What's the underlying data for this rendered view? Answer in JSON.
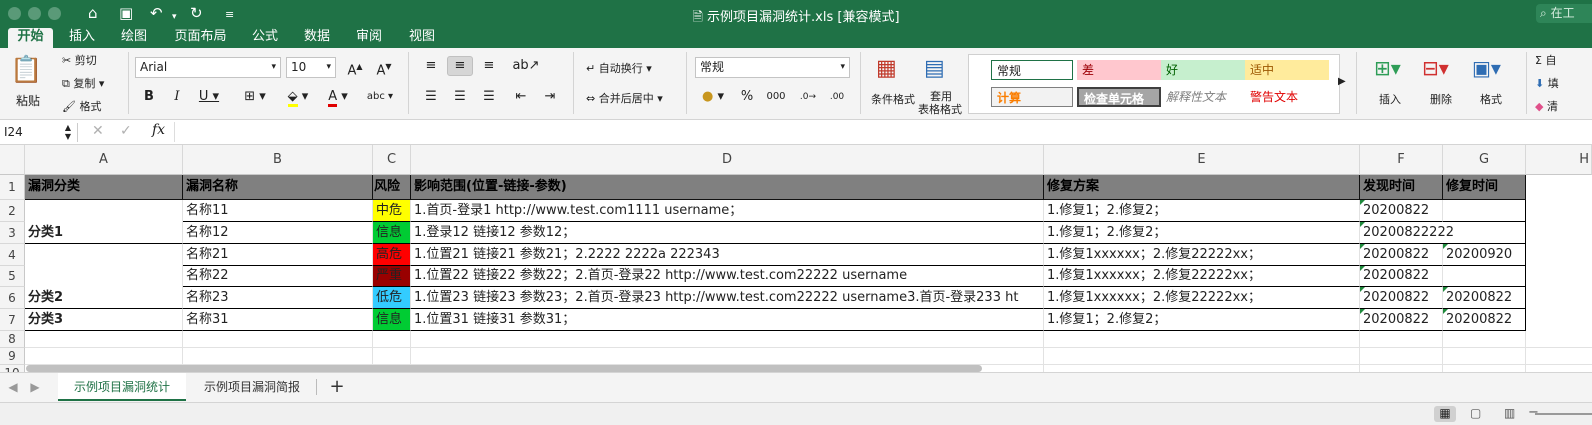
{
  "window": {
    "title": "示例项目漏洞统计.xls  [兼容模式]",
    "search": "在工"
  },
  "tabs": [
    "开始",
    "插入",
    "绘图",
    "页面布局",
    "公式",
    "数据",
    "审阅",
    "视图"
  ],
  "ribbon": {
    "paste": "粘贴",
    "cut": "剪切",
    "copy": "复制",
    "format_painter": "格式",
    "font_name": "Arial",
    "font_size": "10",
    "wrap_text": "自动换行",
    "merge_center": "合并后居中",
    "number_format": "常规",
    "conditional_format": "条件格式",
    "table_format_1": "套用",
    "table_format_2": "表格格式",
    "styles": {
      "normal": "常规",
      "bad": "差",
      "good": "好",
      "neutral": "适中",
      "calc": "计算",
      "check_cell": "检查单元格",
      "explanatory": "解释性文本",
      "warning": "警告文本"
    },
    "insert": "插入",
    "delete": "删除",
    "format": "格式",
    "autosum": "自",
    "fill": "填",
    "clear": "清"
  },
  "formula_bar": {
    "name_box": "I24",
    "fx": "fx",
    "value": ""
  },
  "grid": {
    "columns": [
      "A",
      "B",
      "C",
      "D",
      "E",
      "F",
      "G",
      "H"
    ],
    "rows": [
      "1",
      "2",
      "3",
      "4",
      "5",
      "6",
      "7",
      "8",
      "9",
      "10"
    ],
    "headers": [
      "漏洞分类",
      "漏洞名称",
      "风险",
      "影响范围(位置-链接-参数)",
      "修复方案",
      "发现时间",
      "修复时间"
    ],
    "categories": [
      {
        "label": "分类1"
      },
      {
        "label": "分类2"
      },
      {
        "label": "分类3"
      }
    ],
    "data": [
      {
        "name": "名称11",
        "risk": "中危",
        "scope": "1.首页-登录1  http://www.test.com1111  username；",
        "fix": "1.修复1；2.修复2；",
        "found": "20200822",
        "fixed": ""
      },
      {
        "name": "名称12",
        "risk": "信息",
        "scope": "1.登录12  链接12  参数12；",
        "fix": "1.修复1；2.修复2；",
        "found": "20200822222",
        "fixed": ""
      },
      {
        "name": "名称21",
        "risk": "高危",
        "scope": "1.位置21  链接21  参数21；2.2222  2222a  222343",
        "fix": "1.修复1xxxxxx；2.修复22222xx；",
        "found": "20200822",
        "fixed": "20200920"
      },
      {
        "name": "名称22",
        "risk": "严重",
        "scope": "1.位置22  链接22  参数22；2.首页-登录22  http://www.test.com22222  username",
        "fix": "1.修复1xxxxxx；2.修复22222xx；",
        "found": "20200822",
        "fixed": ""
      },
      {
        "name": "名称23",
        "risk": "低危",
        "scope": "1.位置23  链接23  参数23；2.首页-登录23  http://www.test.com22222  username3.首页-登录233  ht",
        "fix": "1.修复1xxxxxx；2.修复22222xx；",
        "found": "20200822",
        "fixed": "20200822"
      },
      {
        "name": "名称31",
        "risk": "信息",
        "scope": "1.位置31  链接31  参数31；",
        "fix": "1.修复1；2.修复2；",
        "found": "20200822",
        "fixed": "20200822"
      }
    ],
    "risk_colors": {
      "中危": "#ffff00",
      "信息": "#00cc33",
      "高危": "#ff0000",
      "严重": "#990000",
      "低危": "#33ccff"
    }
  },
  "sheets": [
    "示例项目漏洞统计",
    "示例项目漏洞简报"
  ],
  "add_sheet": "+"
}
